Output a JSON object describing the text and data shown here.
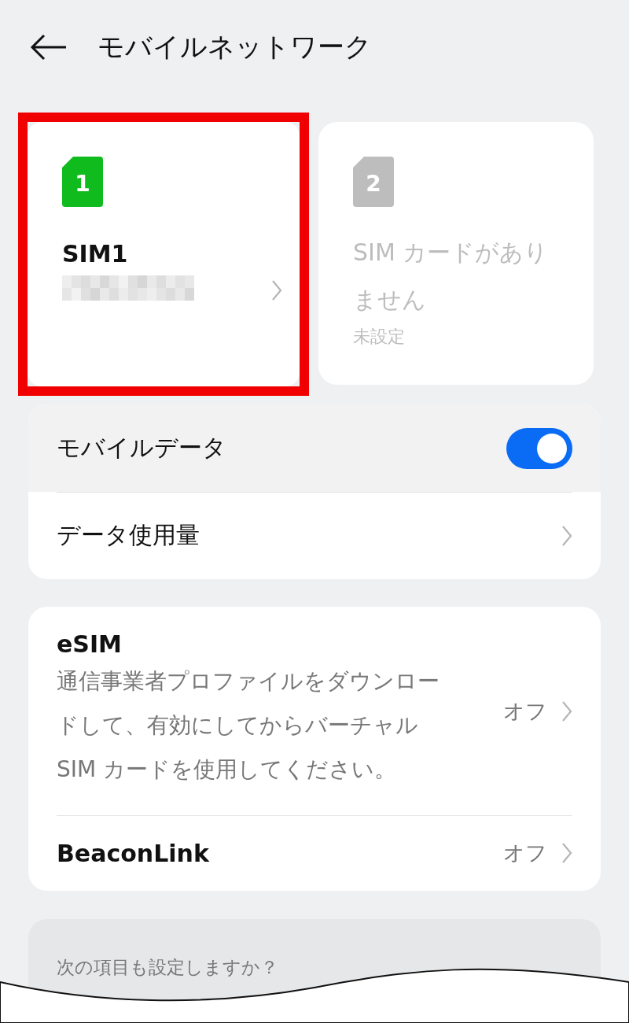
{
  "header": {
    "title": "モバイルネットワーク"
  },
  "sims": [
    {
      "number": "1",
      "name": "SIM1",
      "active": true,
      "highlighted": true
    },
    {
      "number": "2",
      "name": "SIM カードがありません",
      "status": "未設定",
      "active": false,
      "highlighted": false
    }
  ],
  "data_group": [
    {
      "kind": "toggle",
      "label": "モバイルデータ",
      "on": true,
      "pressed": true
    },
    {
      "kind": "link",
      "label": "データ使用量",
      "pressed": false
    }
  ],
  "esim_group": [
    {
      "title": "eSIM",
      "description": "通信事業者プロファイルをダウンロードして、有効にしてからバーチャル SIM カードを使用してください。",
      "value": "オフ"
    },
    {
      "title": "BeaconLink",
      "value": "オフ"
    }
  ],
  "suggestions": {
    "title": "次の項目も設定しますか？"
  }
}
